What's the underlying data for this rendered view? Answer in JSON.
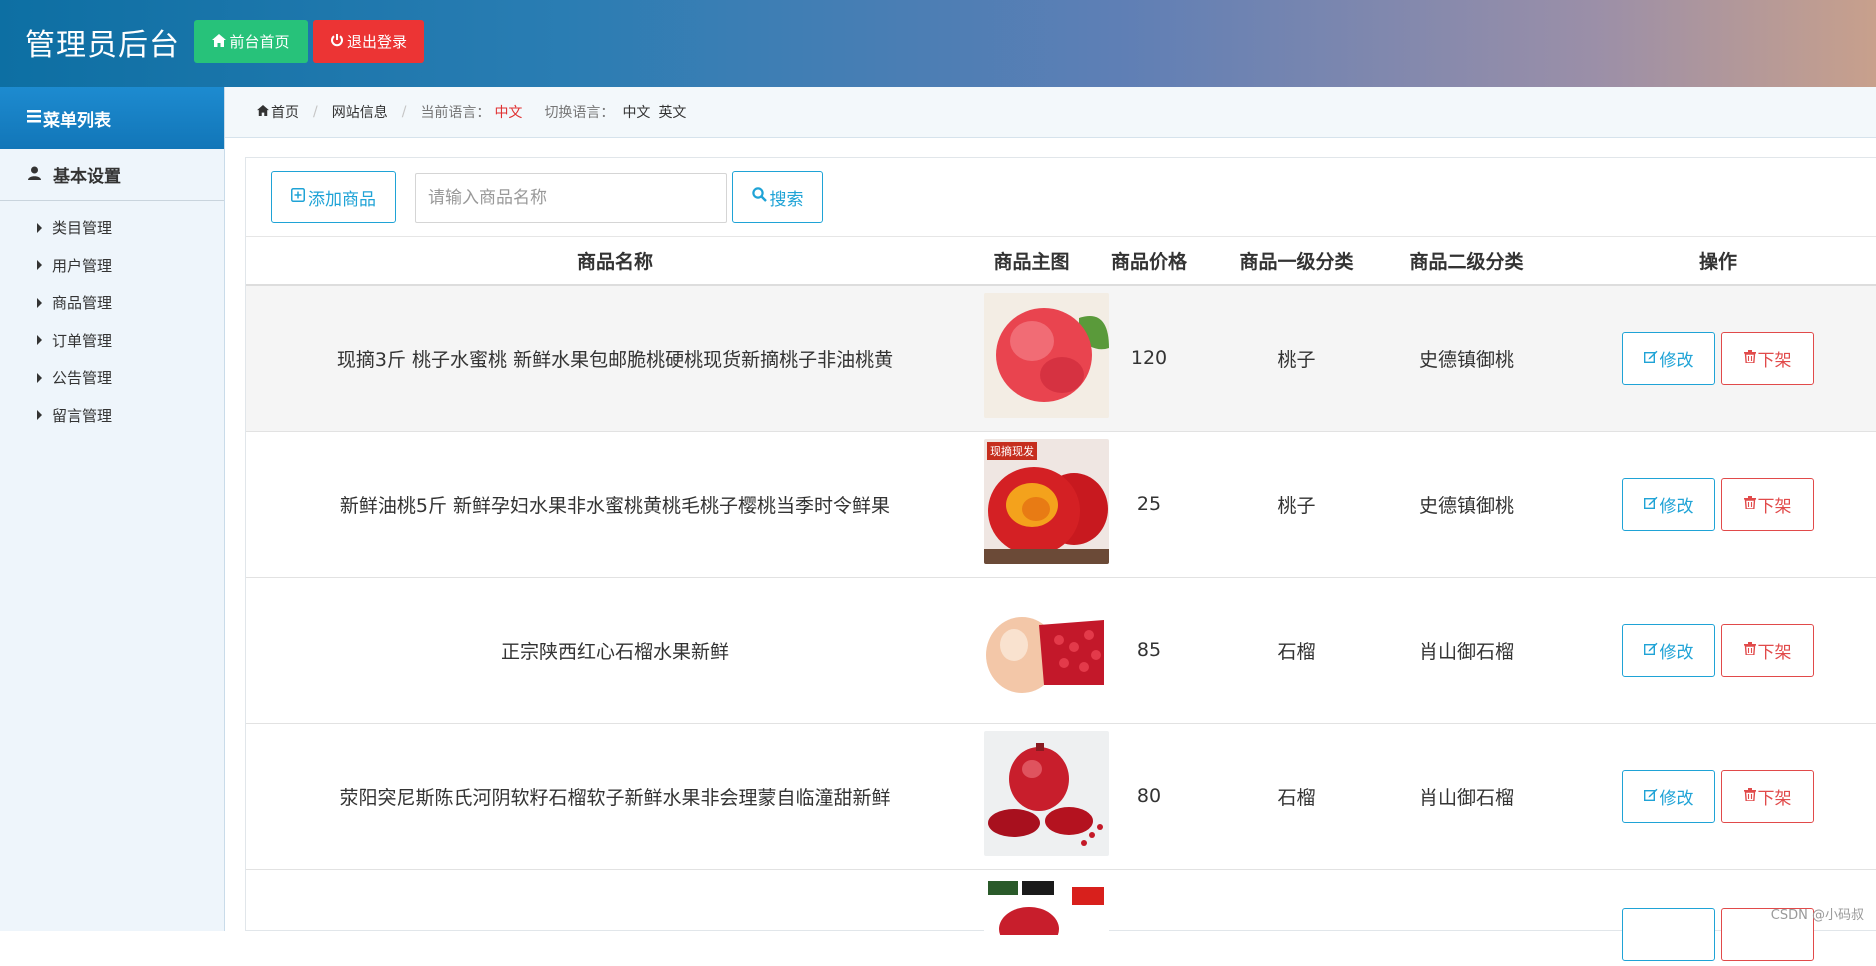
{
  "header": {
    "title": "管理员后台",
    "home_button": "前台首页",
    "logout_button": "退出登录"
  },
  "sidebar": {
    "menu_title": "菜单列表",
    "group_title": "基本设置",
    "items": [
      {
        "label": "类目管理"
      },
      {
        "label": "用户管理"
      },
      {
        "label": "商品管理"
      },
      {
        "label": "订单管理"
      },
      {
        "label": "公告管理"
      },
      {
        "label": "留言管理"
      }
    ]
  },
  "breadcrumb": {
    "home": "首页",
    "site_info": "网站信息",
    "current_lang_label": "当前语言：",
    "current_lang": "中文",
    "switch_label": "切换语言：",
    "option_zh": "中文",
    "option_en": "英文"
  },
  "toolbar": {
    "add_label": "添加商品",
    "search_placeholder": "请输入商品名称",
    "search_label": "搜索"
  },
  "table": {
    "columns": [
      "商品名称",
      "商品主图",
      "商品价格",
      "商品一级分类",
      "商品二级分类",
      "操作"
    ],
    "edit_label": "修改",
    "offline_label": "下架",
    "rows": [
      {
        "name": "现摘3斤 桃子水蜜桃 新鲜水果包邮脆桃硬桃现货新摘桃子非油桃黄",
        "price": "120",
        "cat1": "桃子",
        "cat2": "史德镇御桃",
        "image": "peach-photo"
      },
      {
        "name": "新鲜油桃5斤 新鲜孕妇水果非水蜜桃黄桃毛桃子樱桃当季时令鲜果",
        "price": "25",
        "cat1": "桃子",
        "cat2": "史德镇御桃",
        "image": "nectarine-photo",
        "badge": "现摘现发"
      },
      {
        "name": "正宗陕西红心石榴水果新鲜",
        "price": "85",
        "cat1": "石榴",
        "cat2": "肖山御石榴",
        "image": "pomegranate-photo"
      },
      {
        "name": "荥阳突尼斯陈氏河阴软籽石榴软子新鲜水果非会理蒙自临潼甜新鲜",
        "price": "80",
        "cat1": "石榴",
        "cat2": "肖山御石榴",
        "image": "pomegranate-seeds-photo"
      }
    ]
  },
  "watermark": "CSDN @小码叔",
  "colors": {
    "accent": "#1fa3d6",
    "danger": "#e14a4a",
    "success": "#27c27a",
    "current_lang": "#e03030"
  }
}
